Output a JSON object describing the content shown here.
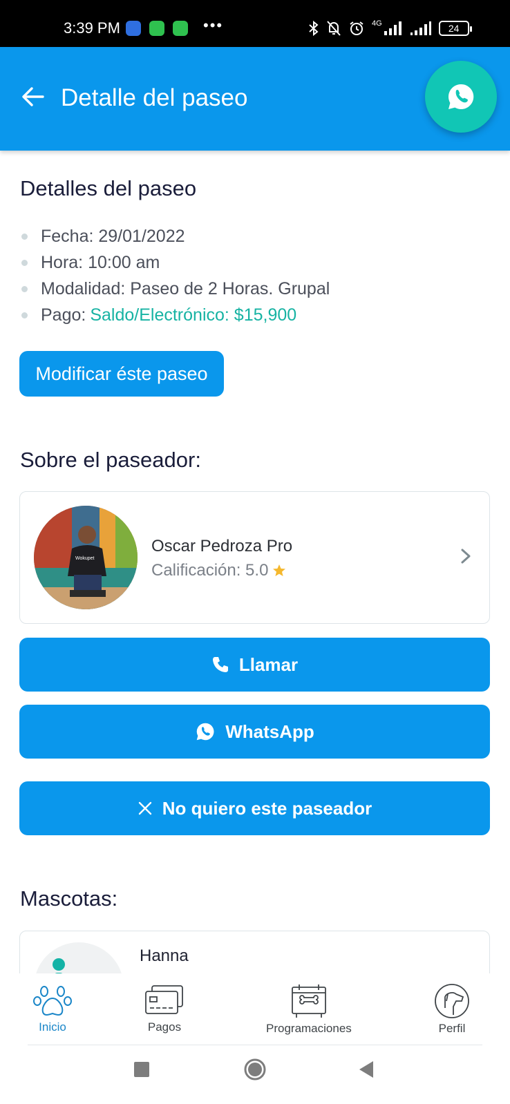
{
  "status_bar": {
    "time": "3:39 PM",
    "dots": "•••",
    "network": "4G",
    "battery": "24"
  },
  "app_bar": {
    "title": "Detalle del paseo"
  },
  "details": {
    "title": "Detalles del paseo",
    "fecha": "Fecha: 29/01/2022",
    "hora": "Hora: 10:00 am",
    "modalidad": "Modalidad: Paseo de 2 Horas. Grupal",
    "pago_label": "Pago:",
    "pago_value": "Saldo/Electrónico: $15,900",
    "modify_button": "Modificar éste paseo"
  },
  "walker": {
    "section_title": "Sobre el paseador:",
    "name": "Oscar Pedroza Pro",
    "rating": "Calificación: 5.0",
    "shirt_text": "Wokupet"
  },
  "actions": {
    "call": "Llamar",
    "whatsapp": "WhatsApp",
    "reject": "No quiero este paseador"
  },
  "pets": {
    "section_title": "Mascotas:",
    "items": [
      {
        "name": "Hanna"
      }
    ]
  },
  "bottom_nav": {
    "items": [
      {
        "label": "Inicio",
        "icon": "paw-icon",
        "active": true
      },
      {
        "label": "Pagos",
        "icon": "credit-card-icon",
        "active": false
      },
      {
        "label": "Programaciones",
        "icon": "calendar-bone-icon",
        "active": false
      },
      {
        "label": "Perfil",
        "icon": "dog-profile-icon",
        "active": false
      }
    ]
  },
  "colors": {
    "primary": "#0a97ec",
    "fab": "#11c6b5",
    "accent_text": "#17b3a3",
    "star": "#f5b82e"
  }
}
